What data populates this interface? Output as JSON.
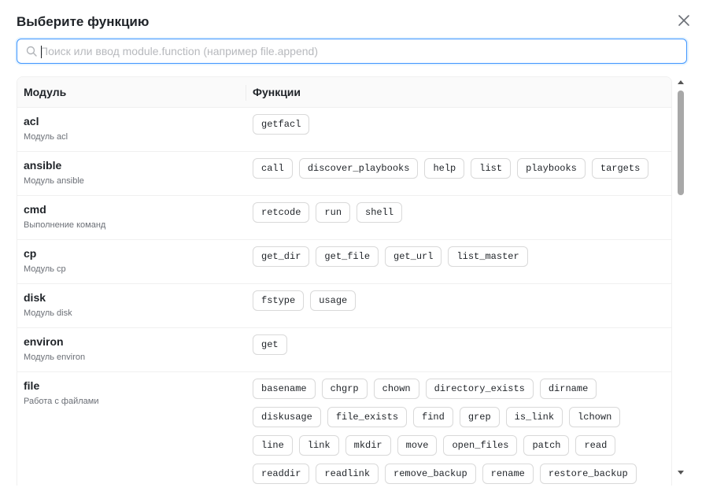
{
  "dialog": {
    "title": "Выберите функцию",
    "close_icon": "close-icon"
  },
  "search": {
    "icon": "search-icon",
    "value": "",
    "placeholder": "Поиск или ввод module.function (например file.append)"
  },
  "table": {
    "columns": {
      "module": "Модуль",
      "functions": "Функции"
    },
    "rows": [
      {
        "name": "acl",
        "desc": "Модуль acl",
        "functions": [
          "getfacl"
        ]
      },
      {
        "name": "ansible",
        "desc": "Модуль ansible",
        "functions": [
          "call",
          "discover_playbooks",
          "help",
          "list",
          "playbooks",
          "targets"
        ]
      },
      {
        "name": "cmd",
        "desc": "Выполнение команд",
        "functions": [
          "retcode",
          "run",
          "shell"
        ]
      },
      {
        "name": "cp",
        "desc": "Модуль cp",
        "functions": [
          "get_dir",
          "get_file",
          "get_url",
          "list_master"
        ]
      },
      {
        "name": "disk",
        "desc": "Модуль disk",
        "functions": [
          "fstype",
          "usage"
        ]
      },
      {
        "name": "environ",
        "desc": "Модуль environ",
        "functions": [
          "get"
        ]
      },
      {
        "name": "file",
        "desc": "Работа с файлами",
        "functions": [
          "basename",
          "chgrp",
          "chown",
          "directory_exists",
          "dirname",
          "diskusage",
          "file_exists",
          "find",
          "grep",
          "is_link",
          "lchown",
          "line",
          "link",
          "mkdir",
          "move",
          "open_files",
          "patch",
          "read",
          "readdir",
          "readlink",
          "remove_backup",
          "rename",
          "restore_backup"
        ]
      }
    ]
  },
  "scrollbar": {
    "position_fraction": 0.0
  }
}
